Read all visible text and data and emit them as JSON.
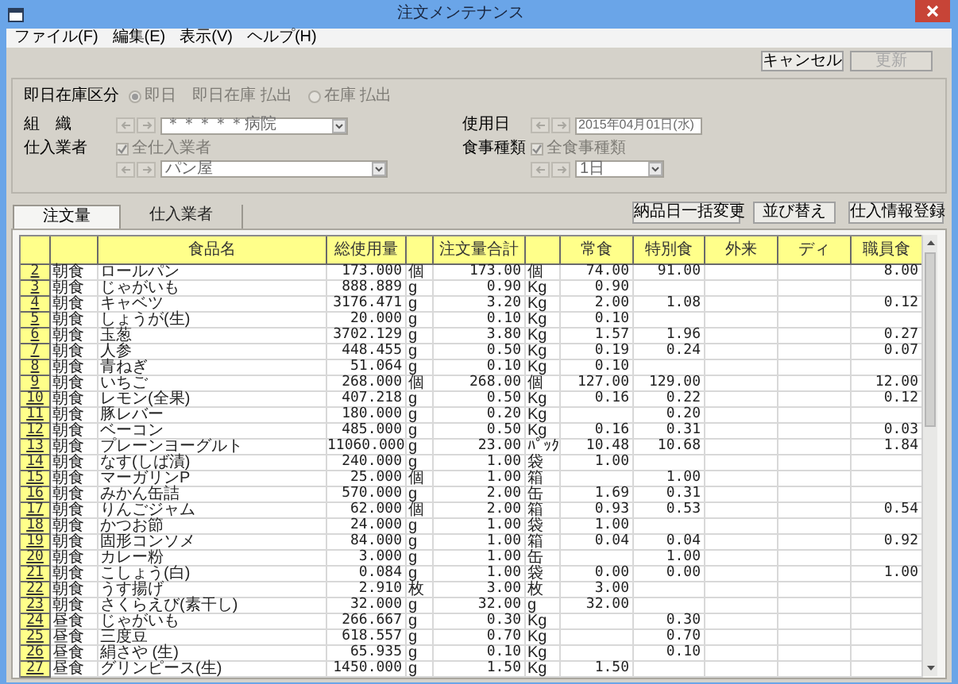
{
  "window": {
    "title": "注文メンテナンス"
  },
  "menu": [
    {
      "label": "ファイル(F)"
    },
    {
      "label": "編集(E)"
    },
    {
      "label": "表示(V)"
    },
    {
      "label": "ヘルプ(H)"
    }
  ],
  "toolbar_buttons": [
    {
      "label": "キャンセル",
      "disabled": false
    },
    {
      "label": "更新",
      "disabled": true
    }
  ],
  "filters": {
    "stock_mode": {
      "label": "即日在庫区分",
      "disabled": true,
      "options": [
        {
          "label": "即日　即日在庫 払出",
          "selected": true
        },
        {
          "label": "在庫 払出",
          "selected": false
        }
      ]
    },
    "organization": {
      "label": "組　織",
      "value": "＊＊＊＊＊病院"
    },
    "use_date": {
      "label": "使用日",
      "value": "2015年04月01日(水)"
    },
    "supplier": {
      "label": "仕入業者",
      "all": {
        "label": "全仕入業者",
        "checked": true,
        "disabled": true
      },
      "value": "パン屋"
    },
    "meal_type": {
      "label": "食事種類",
      "all": {
        "label": "全食事種類",
        "checked": true,
        "disabled": true
      },
      "value": "1日"
    }
  },
  "tabs": [
    {
      "label": "注文量",
      "selected": true
    },
    {
      "label": "仕入業者",
      "selected": false
    }
  ],
  "actions": [
    {
      "label": "納品日一括変更"
    },
    {
      "label": "並び替え"
    },
    {
      "label": "仕入情報登録"
    }
  ],
  "table": {
    "columns": {
      "name": "食品名",
      "total": "総使用量",
      "order_total": "注文量合計",
      "normal": "常食",
      "special": "特別食",
      "outpatient": "外来",
      "day": "ディ",
      "staff": "職員食"
    },
    "rows": [
      {
        "no": "2",
        "meal": "朝食",
        "name": "ロールパン",
        "total": "173.000",
        "unit": "個",
        "order_total": "173.00",
        "order_unit": "個",
        "normal": "74.00",
        "special": "91.00",
        "staff": "8.00"
      },
      {
        "no": "3",
        "meal": "朝食",
        "name": "じゃがいも",
        "total": "888.889",
        "unit": "g",
        "order_total": "0.90",
        "order_unit": "Kg",
        "normal": "0.90"
      },
      {
        "no": "4",
        "meal": "朝食",
        "name": "キャベツ",
        "total": "3176.471",
        "unit": "g",
        "order_total": "3.20",
        "order_unit": "Kg",
        "normal": "2.00",
        "special": "1.08",
        "staff": "0.12"
      },
      {
        "no": "5",
        "meal": "朝食",
        "name": "しょうが(生)",
        "total": "20.000",
        "unit": "g",
        "order_total": "0.10",
        "order_unit": "Kg",
        "normal": "0.10"
      },
      {
        "no": "6",
        "meal": "朝食",
        "name": "玉葱",
        "total": "3702.129",
        "unit": "g",
        "order_total": "3.80",
        "order_unit": "Kg",
        "normal": "1.57",
        "special": "1.96",
        "staff": "0.27"
      },
      {
        "no": "7",
        "meal": "朝食",
        "name": "人参",
        "total": "448.455",
        "unit": "g",
        "order_total": "0.50",
        "order_unit": "Kg",
        "normal": "0.19",
        "special": "0.24",
        "staff": "0.07"
      },
      {
        "no": "8",
        "meal": "朝食",
        "name": "青ねぎ",
        "total": "51.064",
        "unit": "g",
        "order_total": "0.10",
        "order_unit": "Kg",
        "normal": "0.10"
      },
      {
        "no": "9",
        "meal": "朝食",
        "name": "いちご",
        "total": "268.000",
        "unit": "個",
        "order_total": "268.00",
        "order_unit": "個",
        "normal": "127.00",
        "special": "129.00",
        "staff": "12.00"
      },
      {
        "no": "10",
        "meal": "朝食",
        "name": "レモン(全果)",
        "total": "407.218",
        "unit": "g",
        "order_total": "0.50",
        "order_unit": "Kg",
        "normal": "0.16",
        "special": "0.22",
        "staff": "0.12"
      },
      {
        "no": "11",
        "meal": "朝食",
        "name": "豚レバー",
        "total": "180.000",
        "unit": "g",
        "order_total": "0.20",
        "order_unit": "Kg",
        "special": "0.20"
      },
      {
        "no": "12",
        "meal": "朝食",
        "name": "ベーコン",
        "total": "485.000",
        "unit": "g",
        "order_total": "0.50",
        "order_unit": "Kg",
        "normal": "0.16",
        "special": "0.31",
        "staff": "0.03"
      },
      {
        "no": "13",
        "meal": "朝食",
        "name": "プレーンヨーグルト",
        "total": "11060.000",
        "unit": "g",
        "order_total": "23.00",
        "order_unit": "ﾊﾟｯｸ",
        "normal": "10.48",
        "special": "10.68",
        "staff": "1.84"
      },
      {
        "no": "14",
        "meal": "朝食",
        "name": "なす(しば漬)",
        "total": "240.000",
        "unit": "g",
        "order_total": "1.00",
        "order_unit": "袋",
        "normal": "1.00"
      },
      {
        "no": "15",
        "meal": "朝食",
        "name": "マーガリンP",
        "total": "25.000",
        "unit": "個",
        "order_total": "1.00",
        "order_unit": "箱",
        "special": "1.00"
      },
      {
        "no": "16",
        "meal": "朝食",
        "name": "みかん缶詰",
        "total": "570.000",
        "unit": "g",
        "order_total": "2.00",
        "order_unit": "缶",
        "normal": "1.69",
        "special": "0.31"
      },
      {
        "no": "17",
        "meal": "朝食",
        "name": "りんごジャム",
        "total": "62.000",
        "unit": "個",
        "order_total": "2.00",
        "order_unit": "箱",
        "normal": "0.93",
        "special": "0.53",
        "staff": "0.54"
      },
      {
        "no": "18",
        "meal": "朝食",
        "name": "かつお節",
        "total": "24.000",
        "unit": "g",
        "order_total": "1.00",
        "order_unit": "袋",
        "normal": "1.00"
      },
      {
        "no": "19",
        "meal": "朝食",
        "name": "固形コンソメ",
        "total": "84.000",
        "unit": "g",
        "order_total": "1.00",
        "order_unit": "箱",
        "normal": "0.04",
        "special": "0.04",
        "staff": "0.92"
      },
      {
        "no": "20",
        "meal": "朝食",
        "name": "カレー粉",
        "total": "3.000",
        "unit": "g",
        "order_total": "1.00",
        "order_unit": "缶",
        "special": "1.00"
      },
      {
        "no": "21",
        "meal": "朝食",
        "name": "こしょう(白)",
        "total": "0.084",
        "unit": "g",
        "order_total": "1.00",
        "order_unit": "袋",
        "normal": "0.00",
        "special": "0.00",
        "staff": "1.00"
      },
      {
        "no": "22",
        "meal": "朝食",
        "name": "うす揚げ",
        "total": "2.910",
        "unit": "枚",
        "order_total": "3.00",
        "order_unit": "枚",
        "normal": "3.00"
      },
      {
        "no": "23",
        "meal": "朝食",
        "name": "さくらえび(素干し)",
        "total": "32.000",
        "unit": "g",
        "order_total": "32.00",
        "order_unit": "g",
        "normal": "32.00"
      },
      {
        "no": "24",
        "meal": "昼食",
        "name": "じゃがいも",
        "total": "266.667",
        "unit": "g",
        "order_total": "0.30",
        "order_unit": "Kg",
        "special": "0.30"
      },
      {
        "no": "25",
        "meal": "昼食",
        "name": "三度豆",
        "total": "618.557",
        "unit": "g",
        "order_total": "0.70",
        "order_unit": "Kg",
        "special": "0.70"
      },
      {
        "no": "26",
        "meal": "昼食",
        "name": "絹さや (生)",
        "total": "65.935",
        "unit": "g",
        "order_total": "0.10",
        "order_unit": "Kg",
        "special": "0.10"
      },
      {
        "no": "27",
        "meal": "昼食",
        "name": "グリンピース(生)",
        "total": "1450.000",
        "unit": "g",
        "order_total": "1.50",
        "order_unit": "Kg",
        "normal": "1.50"
      }
    ]
  }
}
